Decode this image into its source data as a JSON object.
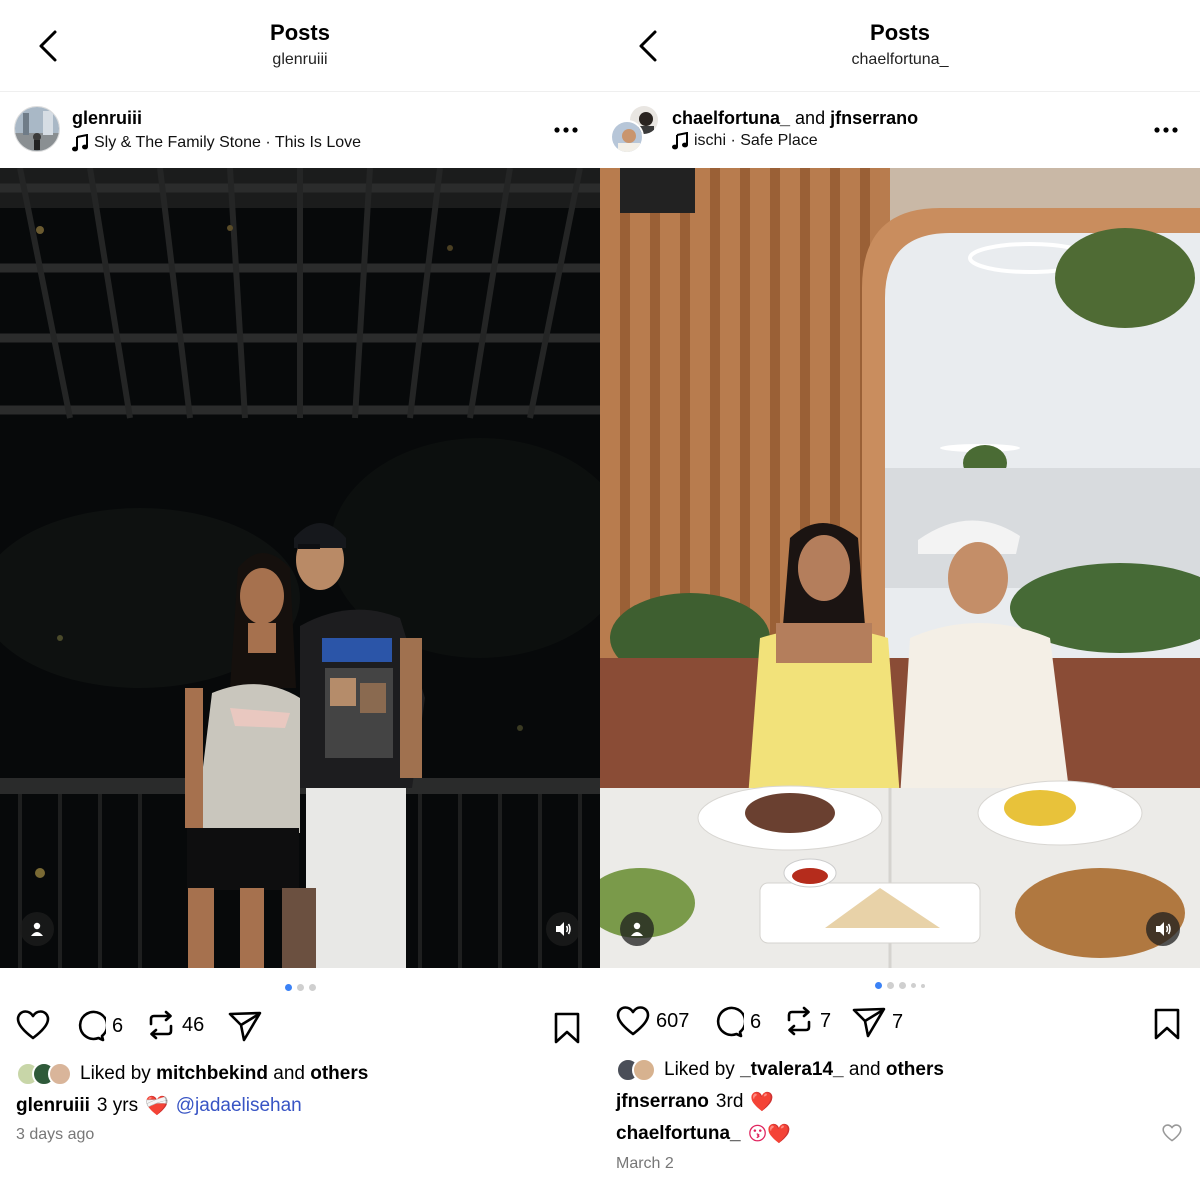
{
  "left": {
    "header": {
      "title": "Posts",
      "subtitle": "glenruiii"
    },
    "post": {
      "username": "glenruiii",
      "music": "Sly & The Family Stone · This Is Love",
      "likes_count": "",
      "comments_count": "6",
      "reposts_count": "46",
      "liked_by_prefix": "Liked by",
      "liked_by_user": "mitchbekind",
      "liked_by_and": "and",
      "liked_by_others": "others",
      "caption_user": "glenruiii",
      "caption_text": "3 yrs",
      "caption_emoji": "❤️‍🩹",
      "caption_mention": "@jadaelisehan",
      "date": "3 days ago"
    }
  },
  "right": {
    "header": {
      "title": "Posts",
      "subtitle": "chaelfortuna_"
    },
    "post": {
      "username_1": "chaelfortuna_",
      "and_word": "and",
      "username_2": "jfnserrano",
      "music": "ischi · Safe Place",
      "likes_count": "607",
      "comments_count": "6",
      "reposts_count": "7",
      "shares_count": "7",
      "liked_by_prefix": "Liked by",
      "liked_by_user": "_tvalera14_",
      "liked_by_and": "and",
      "liked_by_others": "others",
      "comment_1_user": "jfnserrano",
      "comment_1_text": "3rd",
      "comment_1_emoji": "❤️",
      "comment_2_user": "chaelfortuna_",
      "comment_2_emoji": "😗❤️",
      "date": "March 2"
    }
  },
  "icons": {
    "back": "chevron-left-icon",
    "more": "more-horizontal-icon",
    "music": "music-note-icon",
    "like": "heart-icon",
    "comment": "comment-icon",
    "repost": "repost-icon",
    "share": "send-icon",
    "save": "bookmark-icon",
    "tag": "person-tag-icon",
    "mute": "speaker-icon"
  },
  "colors": {
    "mention": "#3854c4",
    "active_dot": "#3b82f6",
    "heart_red": "#e0245e"
  }
}
